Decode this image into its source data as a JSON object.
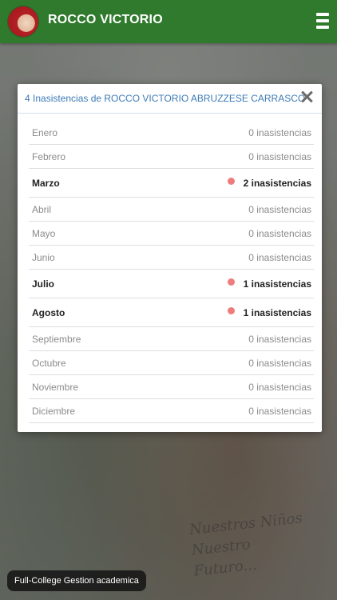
{
  "header": {
    "title": "ROCCO VICTORIO",
    "avatar": "student-avatar",
    "menu_icon": "hamburger-menu-icon",
    "accent_color": "#2f7a2c"
  },
  "background": {
    "motto_lines": [
      "Nuestros Niños",
      "Nuestro Futuro..."
    ]
  },
  "modal": {
    "title": "4 Inasistencias de ROCCO VICTORIO ABRUZZESE CARRASCO",
    "close_icon": "close-icon",
    "title_color": "#3d7bb6",
    "months": [
      {
        "name": "Enero",
        "count": "0 inasistencias",
        "active": false
      },
      {
        "name": "Febrero",
        "count": "0 inasistencias",
        "active": false
      },
      {
        "name": "Marzo",
        "count": "2 inasistencias",
        "active": true
      },
      {
        "name": "Abril",
        "count": "0 inasistencias",
        "active": false
      },
      {
        "name": "Mayo",
        "count": "0 inasistencias",
        "active": false
      },
      {
        "name": "Junio",
        "count": "0 inasistencias",
        "active": false
      },
      {
        "name": "Julio",
        "count": "1 inasistencias",
        "active": true
      },
      {
        "name": "Agosto",
        "count": "1 inasistencias",
        "active": true
      },
      {
        "name": "Septiembre",
        "count": "0 inasistencias",
        "active": false
      },
      {
        "name": "Octubre",
        "count": "0 inasistencias",
        "active": false
      },
      {
        "name": "Noviembre",
        "count": "0 inasistencias",
        "active": false
      },
      {
        "name": "Diciembre",
        "count": "0 inasistencias",
        "active": false
      }
    ],
    "dot_color": "#ef7c7c"
  },
  "toast": {
    "text": "Full-College Gestion academica"
  }
}
